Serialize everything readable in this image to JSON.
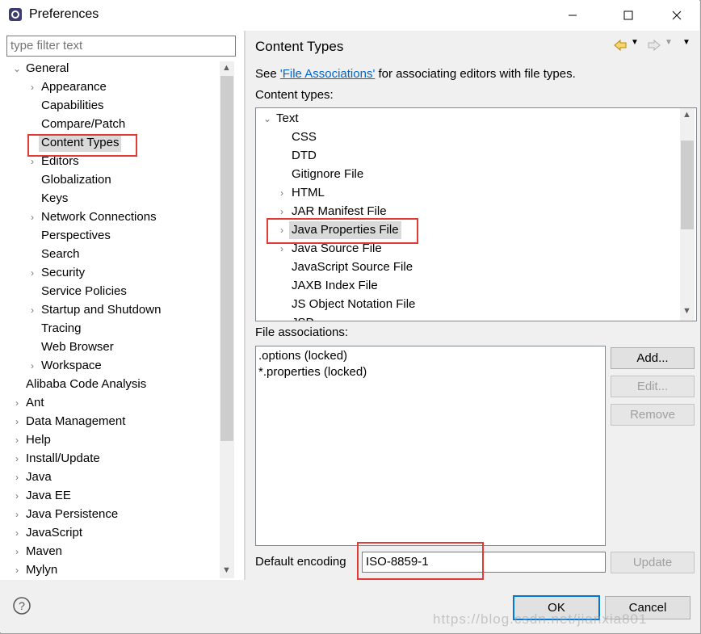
{
  "window": {
    "title": "Preferences"
  },
  "filter": {
    "placeholder": "type filter text"
  },
  "tree": {
    "items": [
      {
        "label": "General",
        "twisty": "open"
      },
      {
        "label": "Appearance",
        "twisty": "closed"
      },
      {
        "label": "Capabilities",
        "twisty": ""
      },
      {
        "label": "Compare/Patch",
        "twisty": ""
      },
      {
        "label": "Content Types",
        "twisty": ""
      },
      {
        "label": "Editors",
        "twisty": "closed"
      },
      {
        "label": "Globalization",
        "twisty": ""
      },
      {
        "label": "Keys",
        "twisty": ""
      },
      {
        "label": "Network Connections",
        "twisty": "closed"
      },
      {
        "label": "Perspectives",
        "twisty": ""
      },
      {
        "label": "Search",
        "twisty": ""
      },
      {
        "label": "Security",
        "twisty": "closed"
      },
      {
        "label": "Service Policies",
        "twisty": ""
      },
      {
        "label": "Startup and Shutdown",
        "twisty": "closed"
      },
      {
        "label": "Tracing",
        "twisty": ""
      },
      {
        "label": "Web Browser",
        "twisty": ""
      },
      {
        "label": "Workspace",
        "twisty": "closed"
      },
      {
        "label": "Alibaba Code Analysis",
        "twisty": ""
      },
      {
        "label": "Ant",
        "twisty": "closed"
      },
      {
        "label": "Data Management",
        "twisty": "closed"
      },
      {
        "label": "Help",
        "twisty": "closed"
      },
      {
        "label": "Install/Update",
        "twisty": "closed"
      },
      {
        "label": "Java",
        "twisty": "closed"
      },
      {
        "label": "Java EE",
        "twisty": "closed"
      },
      {
        "label": "Java Persistence",
        "twisty": "closed"
      },
      {
        "label": "JavaScript",
        "twisty": "closed"
      },
      {
        "label": "Maven",
        "twisty": "closed"
      },
      {
        "label": "Mylyn",
        "twisty": "closed"
      }
    ]
  },
  "page": {
    "title": "Content Types",
    "see_prefix": "See ",
    "see_link": "'File Associations'",
    "see_suffix": " for associating editors with file types.",
    "content_types_label": "Content types:",
    "content_types": [
      {
        "label": "Text",
        "twisty": "open"
      },
      {
        "label": "CSS",
        "twisty": ""
      },
      {
        "label": "DTD",
        "twisty": ""
      },
      {
        "label": "Gitignore File",
        "twisty": ""
      },
      {
        "label": "HTML",
        "twisty": "closed"
      },
      {
        "label": "JAR Manifest File",
        "twisty": "closed"
      },
      {
        "label": "Java Properties File",
        "twisty": "closed"
      },
      {
        "label": "Java Source File",
        "twisty": "closed"
      },
      {
        "label": "JavaScript Source File",
        "twisty": ""
      },
      {
        "label": "JAXB Index File",
        "twisty": ""
      },
      {
        "label": "JS Object Notation File",
        "twisty": ""
      },
      {
        "label": "JSP",
        "twisty": ""
      }
    ],
    "file_assoc_label": "File associations:",
    "file_assocs": [
      ".options (locked)",
      "*.properties (locked)"
    ],
    "add_label": "Add...",
    "edit_label": "Edit...",
    "remove_label": "Remove",
    "encoding_label": "Default encoding",
    "encoding_value": "ISO-8859-1",
    "update_label": "Update"
  },
  "footer": {
    "ok_label": "OK",
    "cancel_label": "Cancel",
    "watermark": "https://blog.csdn.net/jianxia801"
  },
  "colors": {
    "highlight": "#e53935",
    "link": "#0066cc",
    "selection": "#d9d9d9"
  }
}
